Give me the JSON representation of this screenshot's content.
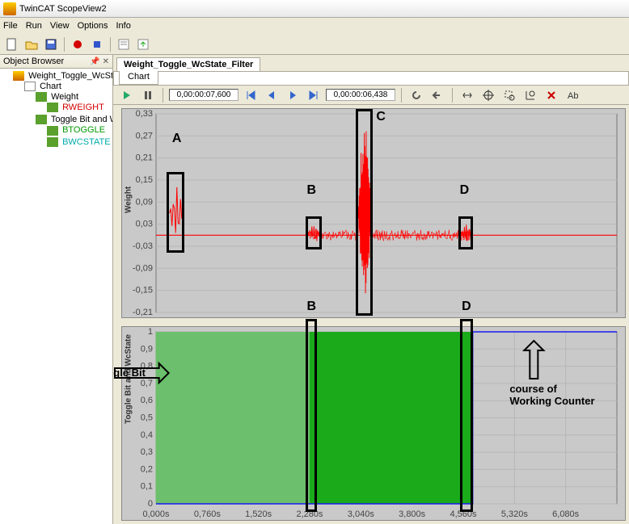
{
  "app": {
    "title": "TwinCAT ScopeView2"
  },
  "menu": {
    "file": "File",
    "run": "Run",
    "view": "View",
    "options": "Options",
    "info": "Info"
  },
  "toolbar_icons": [
    "new",
    "open",
    "save",
    "sep",
    "record",
    "stop",
    "sep",
    "prop",
    "export"
  ],
  "sidebar": {
    "title": "Object Browser",
    "root": "Weight_Toggle_WcState_Filter",
    "chart": "Chart",
    "axis1": "Weight",
    "ch1": "RWEIGHT",
    "axis2": "Toggle Bit and WcState",
    "ch2": "BTOGGLE",
    "ch3": "BWCSTATE"
  },
  "document": {
    "tab": "Weight_Toggle_WcState_Filter",
    "subtab": "Chart"
  },
  "chart_toolbar": {
    "time1": "0,00:00:07,600",
    "time2": "0,00:00:06,438"
  },
  "annotations": {
    "A": "A",
    "B": "B",
    "C": "C",
    "D": "D",
    "toggle_bit": "course of Toggle Bit",
    "working_counter": "course of\nWorking Counter"
  },
  "chart_data": [
    {
      "type": "line",
      "title": "Weight",
      "ylabel": "Weight",
      "ylim": [
        -0.21,
        0.33
      ],
      "yticks": [
        -0.21,
        -0.15,
        -0.09,
        -0.03,
        0.03,
        0.09,
        0.15,
        0.21,
        0.27,
        0.33
      ],
      "xlim": [
        0.0,
        6.84
      ],
      "baseline": 0.0,
      "events": [
        {
          "label": "A",
          "xstart": 0.2,
          "xend": 0.4,
          "peak_min": -0.03,
          "peak_max": 0.15,
          "desc": "short burst"
        },
        {
          "label": "B",
          "xstart": 2.25,
          "xend": 2.45,
          "peak_min": -0.02,
          "peak_max": 0.03,
          "desc": "onset small noise"
        },
        {
          "label": "C",
          "xstart": 3.0,
          "xend": 3.2,
          "peak_min": -0.21,
          "peak_max": 0.33,
          "desc": "large oscillation"
        },
        {
          "label": "D",
          "xstart": 4.52,
          "xend": 4.7,
          "peak_min": -0.02,
          "peak_max": 0.03,
          "desc": "end small noise"
        }
      ],
      "series": [
        {
          "name": "RWEIGHT",
          "color": "#ff0000"
        }
      ]
    },
    {
      "type": "line",
      "title": "Toggle Bit and WcState",
      "ylabel": "Toggle Bit and WcState",
      "ylim": [
        0.0,
        1.0
      ],
      "yticks": [
        0.0,
        0.1,
        0.2,
        0.3,
        0.4,
        0.5,
        0.6,
        0.7,
        0.8,
        0.9,
        1.0
      ],
      "xlim": [
        0.0,
        6.84
      ],
      "xticks_labels": [
        "0,000s",
        "0,760s",
        "1,520s",
        "2,280s",
        "3,040s",
        "3,800s",
        "4,560s",
        "5,320s",
        "6,080s"
      ],
      "xticks": [
        0.0,
        0.76,
        1.52,
        2.28,
        3.04,
        3.8,
        4.56,
        5.32,
        6.08
      ],
      "series": [
        {
          "name": "BTOGGLE",
          "color": "#00aa00",
          "pattern": "square_0_1",
          "region": [
            0.0,
            4.7
          ],
          "desc": "dense 0/1 toggle; fades after D; course of Toggle Bit"
        },
        {
          "name": "BWCSTATE",
          "color": "#0000ff",
          "segments": [
            {
              "x": [
                0.0,
                4.7
              ],
              "y": 0.0
            },
            {
              "x": [
                4.7,
                6.84
              ],
              "y": 1.0
            }
          ],
          "desc": "course of Working Counter"
        }
      ]
    }
  ]
}
